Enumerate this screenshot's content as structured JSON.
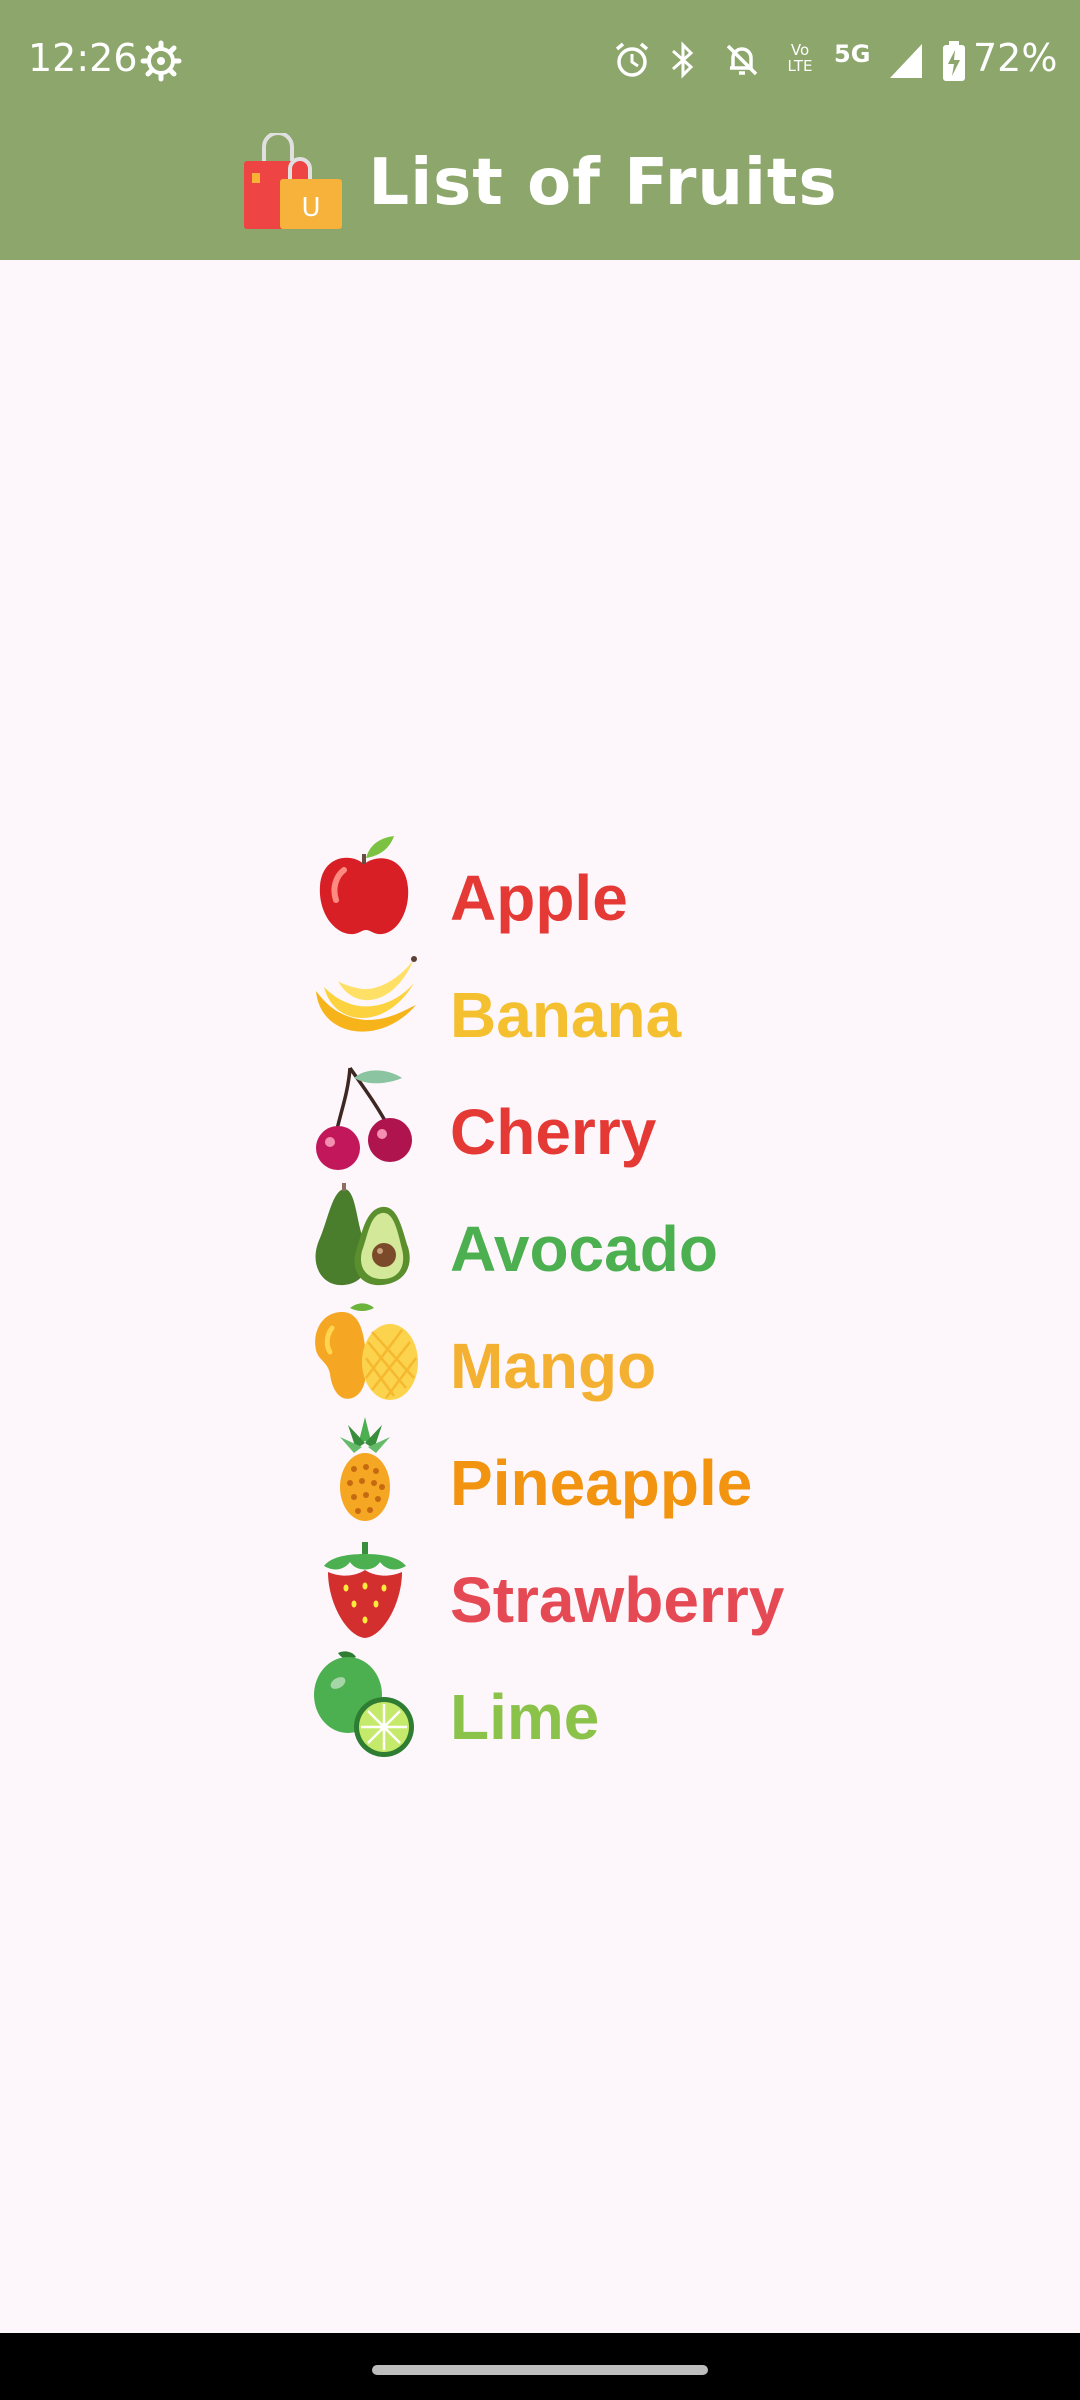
{
  "status_bar": {
    "time": "12:26",
    "battery": "72%",
    "icons": [
      "settings-gear-icon",
      "alarm-icon",
      "bluetooth-icon",
      "bell-off-icon",
      "volte-icon",
      "5g-icon",
      "signal-icon",
      "battery-charging-icon"
    ],
    "volte_label_top": "Vo",
    "volte_label_bottom": "LTE",
    "network_label": "5G"
  },
  "app_bar": {
    "title": "List of Fruits",
    "icon": "shopping-bags-icon",
    "icon_letter": "U",
    "background": "#8ca66b"
  },
  "fruits": [
    {
      "name": "Apple",
      "icon": "apple-icon",
      "color": "#e53935"
    },
    {
      "name": "Banana",
      "icon": "banana-icon",
      "color": "#f4c030"
    },
    {
      "name": "Cherry",
      "icon": "cherry-icon",
      "color": "#e53935"
    },
    {
      "name": "Avocado",
      "icon": "avocado-icon",
      "color": "#4caf50"
    },
    {
      "name": "Mango",
      "icon": "mango-icon",
      "color": "#f4b030"
    },
    {
      "name": "Pineapple",
      "icon": "pineapple-icon",
      "color": "#f29410"
    },
    {
      "name": "Strawberry",
      "icon": "strawberry-icon",
      "color": "#e54a54"
    },
    {
      "name": "Lime",
      "icon": "lime-icon",
      "color": "#8bc34a"
    }
  ]
}
